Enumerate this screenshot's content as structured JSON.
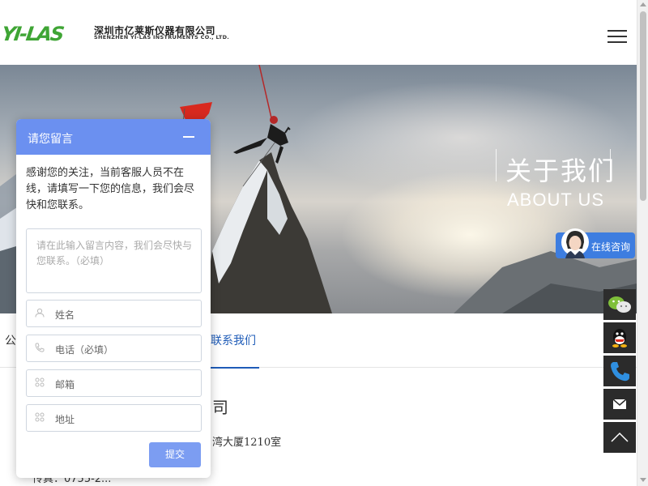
{
  "header": {
    "logo_mark": "YI-LAS",
    "company_cn": "深圳市亿莱斯仪器有限公司",
    "company_en": "SHENZHEN YI-LAS INSTRUMENTS CO., LTD.",
    "menu_icon": "hamburger-menu-icon"
  },
  "banner": {
    "title_cn": "关于我们",
    "title_en": "ABOUT US"
  },
  "consult": {
    "label": "在线咨询"
  },
  "tabs": {
    "left_partial": "公",
    "active": "联系我们"
  },
  "content": {
    "company_partial": "司",
    "address_partial": "湾大厦1210室",
    "fax_partial": "传真：0755-2..."
  },
  "chat": {
    "title": "请您留言",
    "message": "感谢您的关注，当前客服人员不在线，请填写一下您的信息，我们会尽快和您联系。",
    "textarea_placeholder": "请在此输入留言内容，我们会尽快与您联系。（必填）",
    "name_placeholder": "姓名",
    "phone_placeholder": "电话（必填）",
    "email_placeholder": "邮箱",
    "address_placeholder": "地址",
    "submit_label": "提交"
  },
  "sidebar": {
    "items": [
      "wechat-icon",
      "qq-icon",
      "phone-icon",
      "mail-icon",
      "back-to-top-icon"
    ]
  },
  "colors": {
    "accent": "#1f5cb8",
    "chat_header": "#6b90f0",
    "logo_green": "#3fa535"
  }
}
